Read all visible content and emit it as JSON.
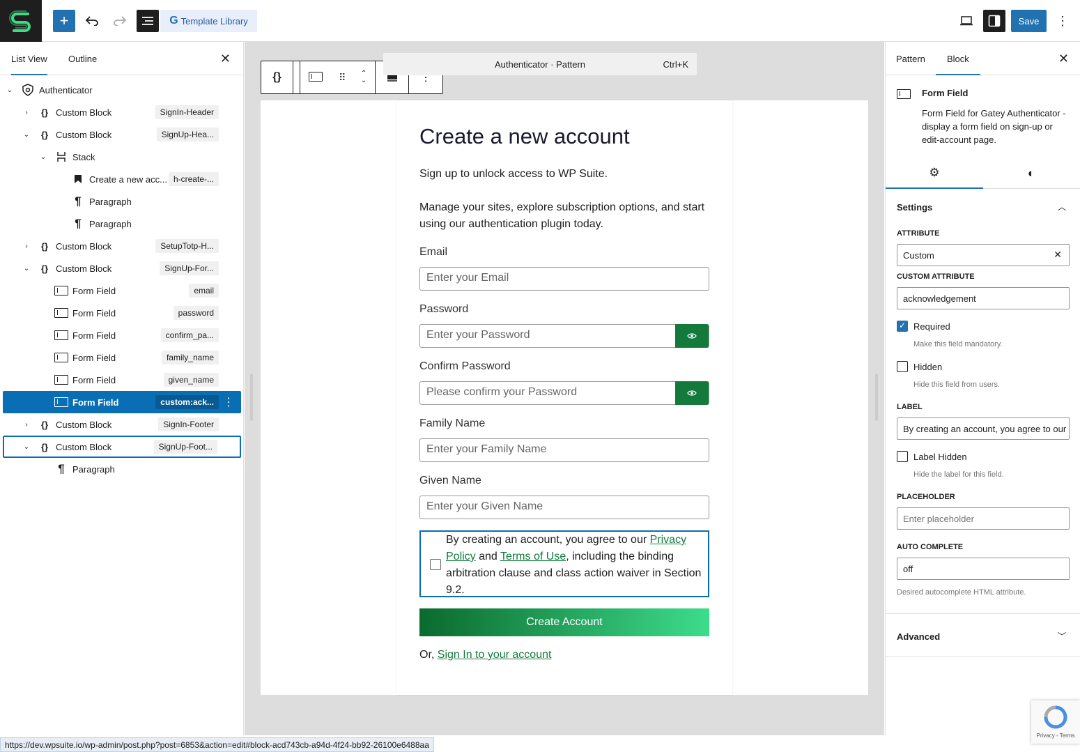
{
  "toolbar": {
    "template_library_label": "Template Library",
    "save_label": "Save"
  },
  "left_panel": {
    "tabs": [
      "List View",
      "Outline"
    ],
    "tree": [
      {
        "label": "Authenticator",
        "tag": ""
      },
      {
        "label": "Custom Block",
        "tag": "SignIn-Header"
      },
      {
        "label": "Custom Block",
        "tag": "SignUp-Hea..."
      },
      {
        "label": "Stack",
        "tag": ""
      },
      {
        "label": "Create a new acc...",
        "tag": "h-create-..."
      },
      {
        "label": "Paragraph",
        "tag": ""
      },
      {
        "label": "Paragraph",
        "tag": ""
      },
      {
        "label": "Custom Block",
        "tag": "SetupTotp-H..."
      },
      {
        "label": "Custom Block",
        "tag": "SignUp-For..."
      },
      {
        "label": "Form Field",
        "tag": "email"
      },
      {
        "label": "Form Field",
        "tag": "password"
      },
      {
        "label": "Form Field",
        "tag": "confirm_pa..."
      },
      {
        "label": "Form Field",
        "tag": "family_name"
      },
      {
        "label": "Form Field",
        "tag": "given_name"
      },
      {
        "label": "Form Field",
        "tag": "custom:ack..."
      },
      {
        "label": "Custom Block",
        "tag": "SignIn-Footer"
      },
      {
        "label": "Custom Block",
        "tag": "SignUp-Foot..."
      },
      {
        "label": "Paragraph",
        "tag": ""
      }
    ]
  },
  "canvas": {
    "command_bar": {
      "title": "Authenticator · Pattern",
      "shortcut": "Ctrl+K"
    },
    "form": {
      "title": "Create a new account",
      "intro": "Sign up to unlock access to WP Suite.",
      "body": "Manage your sites, explore subscription options, and start using our authentication plugin today.",
      "fields": [
        {
          "label": "Email",
          "placeholder": "Enter your Email"
        },
        {
          "label": "Password",
          "placeholder": "Enter your Password"
        },
        {
          "label": "Confirm Password",
          "placeholder": "Please confirm your Password"
        },
        {
          "label": "Family Name",
          "placeholder": "Enter your Family Name"
        },
        {
          "label": "Given Name",
          "placeholder": "Enter your Given Name"
        }
      ],
      "ack": {
        "pre": "By creating an account, you agree to our ",
        "privacy": "Privacy Policy",
        "and": " and ",
        "terms": "Terms of Use",
        "post": ", including the binding arbitration clause and class action waiver in Section 9.2."
      },
      "submit": "Create Account",
      "signin_pre": "Or, ",
      "signin_link": "Sign In to your account"
    }
  },
  "right_panel": {
    "tabs": [
      "Pattern",
      "Block"
    ],
    "block_title": "Form Field",
    "block_desc": "Form Field for Gatey Authenticator - display a form field on sign-up or edit-account page.",
    "settings_title": "Settings",
    "attribute_label": "ATTRIBUTE",
    "attribute_value": "Custom",
    "custom_attr_label": "CUSTOM ATTRIBUTE",
    "custom_attr_value": "acknowledgement",
    "required_label": "Required",
    "required_help": "Make this field mandatory.",
    "required_checked": true,
    "hidden_label": "Hidden",
    "hidden_help": "Hide this field from users.",
    "label_label": "LABEL",
    "label_value": "By creating an account, you agree to our",
    "label_hidden_label": "Label Hidden",
    "label_hidden_help": "Hide the label for this field.",
    "placeholder_label": "PLACEHOLDER",
    "placeholder_placeholder": "Enter placeholder",
    "autocomplete_label": "AUTO COMPLETE",
    "autocomplete_value": "off",
    "autocomplete_help": "Desired autocomplete HTML attribute.",
    "advanced_title": "Advanced"
  },
  "status_url": "https://dev.wpsuite.io/wp-admin/post.php?post=6853&action=edit#block-acd743cb-a94d-4f24-bb92-26100e6488aa",
  "recaptcha_text": "Privacy - Terms",
  "colors": {
    "accent": "#2271b1",
    "selection": "#0a6eb4",
    "brand_green": "#137a3c"
  }
}
